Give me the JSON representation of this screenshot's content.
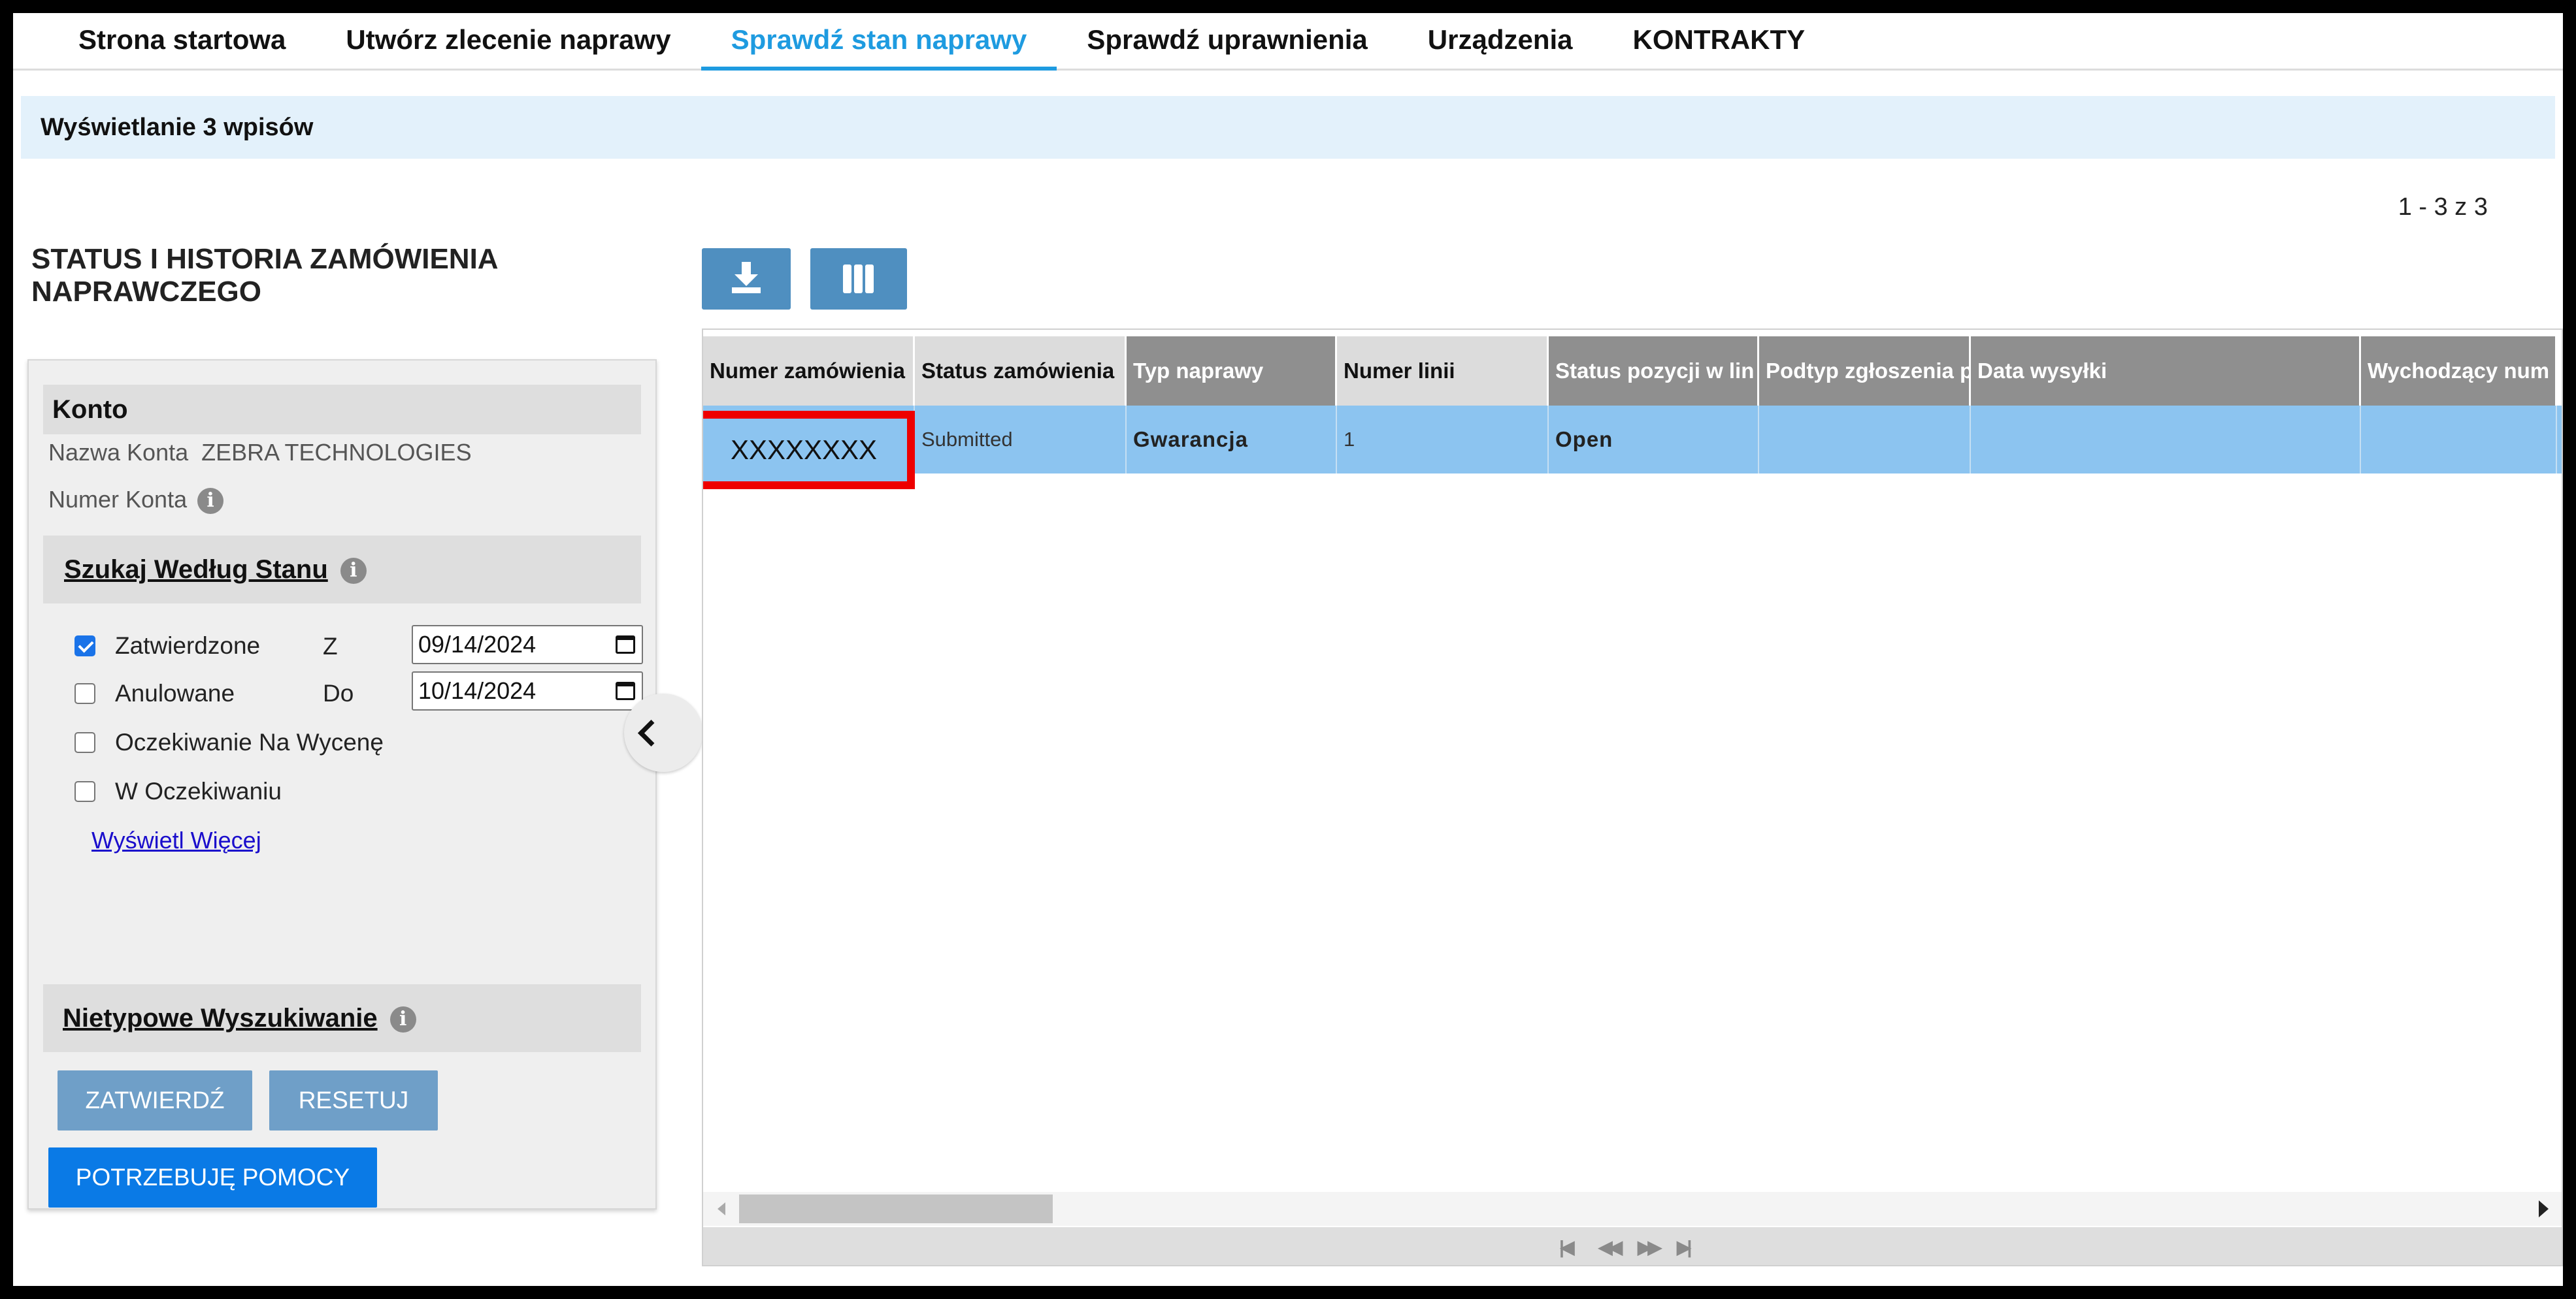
{
  "nav": {
    "tabs": [
      {
        "label": "Strona startowa"
      },
      {
        "label": "Utwórz zlecenie naprawy"
      },
      {
        "label": "Sprawdź stan naprawy",
        "active": true
      },
      {
        "label": "Sprawdź uprawnienia"
      },
      {
        "label": "Urządzenia"
      },
      {
        "label": "KONTRAKTY"
      }
    ]
  },
  "info_bar": "Wyświetlanie 3 wpisów",
  "pagination_count": "1 - 3 z 3",
  "page_title": "STATUS I HISTORIA ZAMÓWIENIA NAPRAWCZEGO",
  "left_panel": {
    "account_heading": "Konto",
    "account_name_label": "Nazwa Konta",
    "account_name_value": "ZEBRA TECHNOLOGIES",
    "account_number_label": "Numer Konta",
    "search_by_status_heading": "Szukaj Według Stanu",
    "statuses": [
      {
        "label": "Zatwierdzone",
        "checked": true
      },
      {
        "label": "Anulowane",
        "checked": false
      },
      {
        "label": "Oczekiwanie Na Wycenę",
        "checked": false
      },
      {
        "label": "W Oczekiwaniu",
        "checked": false
      }
    ],
    "from_label": "Z",
    "from_date": "09/14/2024",
    "to_label": "Do",
    "to_date": "10/14/2024",
    "show_more": "Wyświetl Więcej",
    "custom_search_heading": "Nietypowe Wyszukiwanie",
    "submit_label": "ZATWIERDŹ",
    "reset_label": "RESETUJ",
    "help_label": "POTRZEBUJĘ POMOCY"
  },
  "toolbar": {
    "download_icon": "download-icon",
    "columns_icon": "columns-icon"
  },
  "table": {
    "columns": [
      "Numer zamówienia",
      "Status zamówienia",
      "Typ naprawy",
      "Numer linii",
      "Status pozycji w lin",
      "Podtyp zgłoszenia p",
      "Data wysyłki",
      "Wychodzący num"
    ],
    "rows": [
      {
        "order_number": "XXXXXXXX",
        "order_status": "Submitted",
        "repair_type": "Gwarancja",
        "line_number": "1",
        "line_status": "Open",
        "request_subtype": "",
        "ship_date": "",
        "outbound_number": ""
      }
    ]
  },
  "colors": {
    "active_tab": "#1e9be0",
    "row_highlight": "#8cc4f0",
    "highlight_box": "#ee0000",
    "primary_button": "#0a7ae6"
  }
}
